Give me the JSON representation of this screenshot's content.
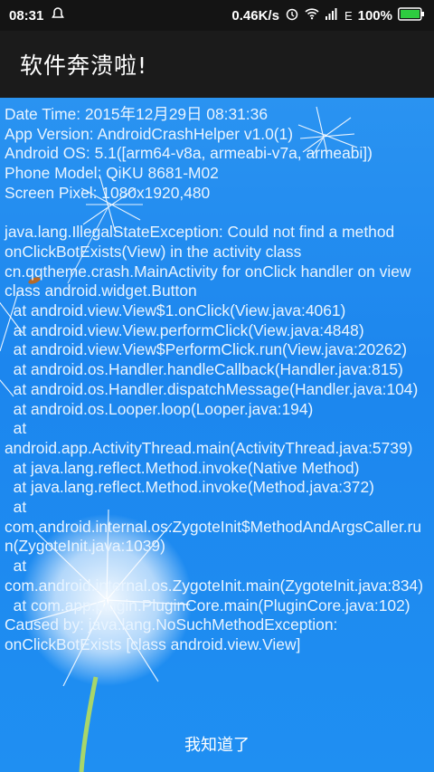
{
  "status_bar": {
    "time": "08:31",
    "speed": "0.46K/s",
    "network": "E",
    "battery": "100%",
    "icons": [
      "notification-icon",
      "alarm-icon",
      "wifi-icon",
      "signal-icon",
      "battery-icon"
    ]
  },
  "toolbar": {
    "title": "软件奔溃啦!"
  },
  "crash_log": {
    "lines": [
      "Date Time: 2015年12月29日 08:31:36",
      "App Version: AndroidCrashHelper v1.0(1)",
      "Android OS: 5.1([arm64-v8a, armeabi-v7a, armeabi])",
      "Phone Model: QiKU 8681-M02",
      "Screen Pixel: 1080x1920,480",
      "",
      "java.lang.IllegalStateException: Could not find a method onClickBotExists(View) in the activity class cn.qqtheme.crash.MainActivity for onClick handler on view class android.widget.Button",
      "  at android.view.View$1.onClick(View.java:4061)",
      "  at android.view.View.performClick(View.java:4848)",
      "  at android.view.View$PerformClick.run(View.java:20262)",
      "  at android.os.Handler.handleCallback(Handler.java:815)",
      "  at android.os.Handler.dispatchMessage(Handler.java:104)",
      "  at android.os.Looper.loop(Looper.java:194)",
      "  at android.app.ActivityThread.main(ActivityThread.java:5739)",
      "  at java.lang.reflect.Method.invoke(Native Method)",
      "  at java.lang.reflect.Method.invoke(Method.java:372)",
      "  at com.android.internal.os.ZygoteInit$MethodAndArgsCaller.run(ZygoteInit.java:1039)",
      "  at com.android.internal.os.ZygoteInit.main(ZygoteInit.java:834)",
      "  at com.app.plugin.PluginCore.main(PluginCore.java:102)",
      "Caused by: java.lang.NoSuchMethodException: onClickBotExists [class android.view.View]"
    ]
  },
  "ok_button": {
    "label": "我知道了"
  },
  "colors": {
    "background": "#1a82e8",
    "toolbar": "#1b1b1b",
    "status_bar": "#141414",
    "text": "#e8f4ff"
  }
}
